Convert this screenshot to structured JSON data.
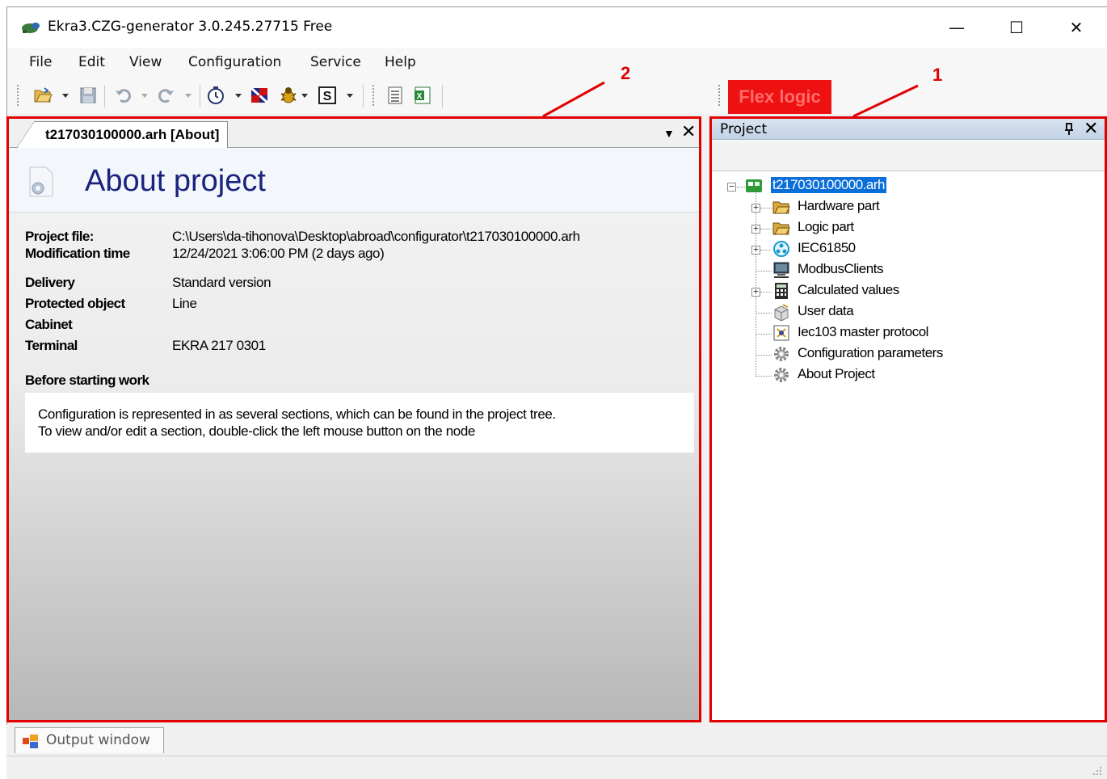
{
  "window": {
    "title": "Ekra3.CZG-generator 3.0.245.27715 Free",
    "minimize": "—",
    "maximize": "☐",
    "close": "✕"
  },
  "menu": {
    "file": "File",
    "edit": "Edit",
    "view": "View",
    "configuration": "Configuration",
    "service": "Service",
    "help": "Help"
  },
  "toolbar": {
    "flex_logic": "Flex logic"
  },
  "annotations": {
    "label_1": "1",
    "label_2": "2"
  },
  "document": {
    "tab_label": "t217030100000.arh [About]",
    "tab_dropdown": "▼",
    "tab_close": "✕",
    "title": "About project",
    "fields": {
      "project_file_label": "Project file:",
      "project_file_value": "C:\\Users\\da-tihonova\\Desktop\\abroad\\configurator\\t217030100000.arh",
      "modification_label": "Modification time",
      "modification_value": "12/24/2021 3:06:00 PM (2 days ago)",
      "delivery_label": "Delivery",
      "delivery_value": "Standard version",
      "protected_label": "Protected object",
      "protected_value": "Line",
      "cabinet_label": "Cabinet",
      "terminal_label": "Terminal",
      "terminal_value": "EKRA 217 0301",
      "before_label": "Before starting work"
    },
    "notice": {
      "line1": "Configuration is represented in as several sections, which can be found in the project tree.",
      "line2": "To view and/or edit a section, double-click the left mouse button on the node"
    }
  },
  "project_panel": {
    "title": "Project",
    "pin": "ᵠ",
    "close": "✕",
    "tree": {
      "root": "t217030100000.arh",
      "items": [
        {
          "label": "Hardware part",
          "icon": "folder-icon",
          "expandable": true
        },
        {
          "label": "Logic part",
          "icon": "folder-icon",
          "expandable": true
        },
        {
          "label": "IEC61850",
          "icon": "network-icon",
          "expandable": true
        },
        {
          "label": "ModbusClients",
          "icon": "computer-icon",
          "expandable": false
        },
        {
          "label": "Calculated values",
          "icon": "calculator-icon",
          "expandable": true
        },
        {
          "label": "User data",
          "icon": "box-icon",
          "expandable": false
        },
        {
          "label": "Iec103 master protocol",
          "icon": "protocol-icon",
          "expandable": false
        },
        {
          "label": "Configuration parameters",
          "icon": "gear-icon",
          "expandable": false
        },
        {
          "label": "About Project",
          "icon": "gear-icon",
          "expandable": false
        }
      ]
    }
  },
  "bottom": {
    "output_tab": "Output window"
  },
  "colors": {
    "annotation_red": "#e00000",
    "selection_blue": "#0a6fd8",
    "title_blue": "#1a237e",
    "flex_logic_bg": "#ee1111"
  }
}
